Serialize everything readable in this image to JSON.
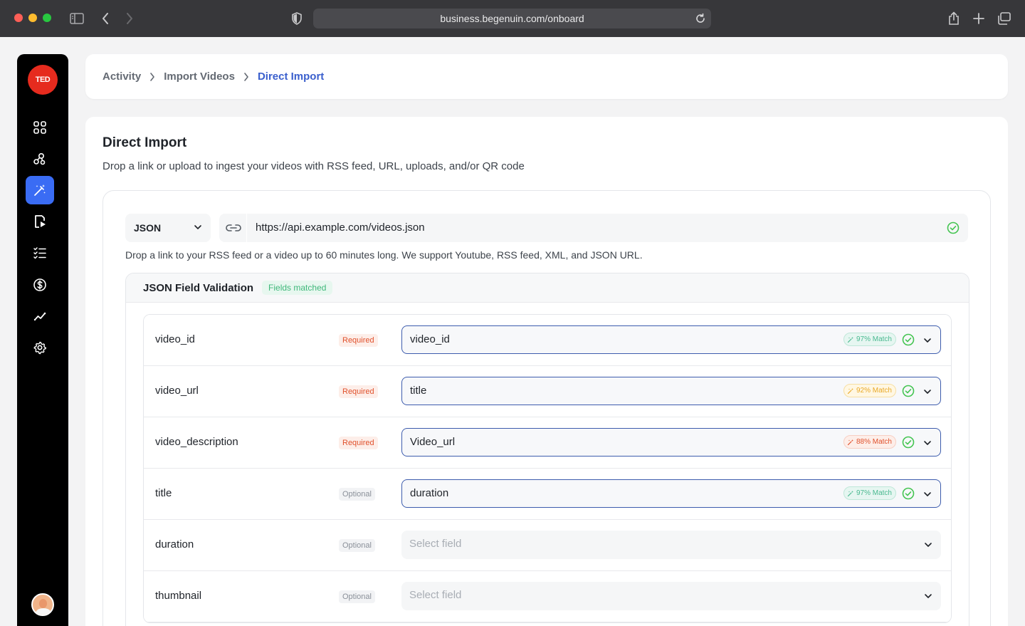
{
  "browser": {
    "url": "business.begenuin.com/onboard"
  },
  "sidebar": {
    "brand": "TED",
    "items": [
      {
        "icon": "grid-icon"
      },
      {
        "icon": "community-icon"
      },
      {
        "icon": "magic-wand-icon",
        "active": true
      },
      {
        "icon": "video-file-icon"
      },
      {
        "icon": "list-icon"
      },
      {
        "icon": "dollar-icon"
      },
      {
        "icon": "analytics-icon"
      },
      {
        "icon": "settings-icon"
      }
    ]
  },
  "breadcrumb": {
    "items": [
      "Activity",
      "Import Videos",
      "Direct Import"
    ]
  },
  "main": {
    "title": "Direct Import",
    "subtitle": "Drop a link or upload to ingest your videos with RSS feed, URL, uploads, and/or QR code",
    "type_select": "JSON",
    "url_value": "https://api.example.com/videos.json",
    "url_help": "Drop a link to your RSS feed or a video up to 60 minutes long. We support Youtube, RSS feed, XML, and JSON URL."
  },
  "validation": {
    "title": "JSON Field Validation",
    "badge": "Fields matched",
    "placeholder": "Select field",
    "rows": [
      {
        "name": "video_id",
        "tag": "Required",
        "value": "video_id",
        "match": "97% Match",
        "match_color": "green"
      },
      {
        "name": "video_url",
        "tag": "Required",
        "value": "title",
        "match": "92% Match",
        "match_color": "yellow"
      },
      {
        "name": "video_description",
        "tag": "Required",
        "value": "Video_url",
        "match": "88% Match",
        "match_color": "red"
      },
      {
        "name": "title",
        "tag": "Optional",
        "value": "duration",
        "match": "97% Match",
        "match_color": "green"
      },
      {
        "name": "duration",
        "tag": "Optional",
        "value": "",
        "match": ""
      },
      {
        "name": "thumbnail",
        "tag": "Optional",
        "value": "",
        "match": ""
      }
    ]
  },
  "colors": {
    "accent": "#3a6cf4",
    "brand": "#e62b1e",
    "breadcrumb_current": "#3a5fcd",
    "success": "#44c451"
  }
}
